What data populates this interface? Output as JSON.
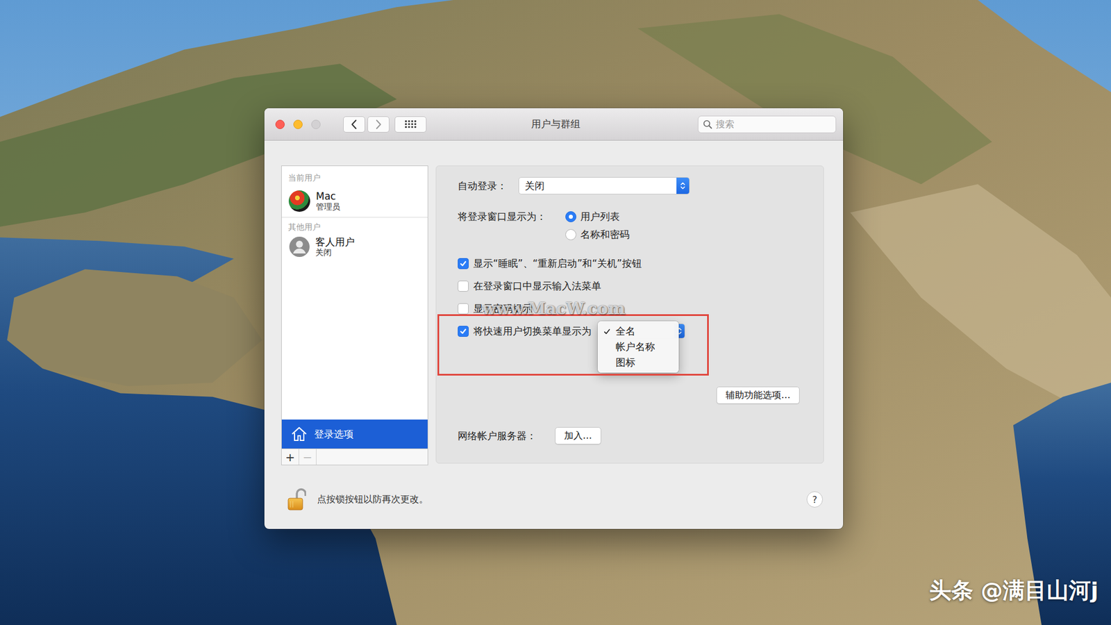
{
  "window": {
    "title": "用户与群组"
  },
  "search": {
    "placeholder": "搜索"
  },
  "sidebar": {
    "sections": [
      {
        "header": "当前用户",
        "users": [
          {
            "name": "Mac",
            "role": "管理员",
            "selected": false
          }
        ]
      },
      {
        "header": "其他用户",
        "users": [
          {
            "name": "客人用户",
            "role": "关闭",
            "selected": false
          }
        ]
      }
    ],
    "login_options": {
      "label": "登录选项",
      "selected": true
    },
    "add": "+",
    "remove": "−",
    "remove_disabled": true
  },
  "settings": {
    "auto_login": {
      "label": "自动登录：",
      "value": "关闭"
    },
    "login_window": {
      "label": "将登录窗口显示为：",
      "options": [
        {
          "label": "用户列表",
          "selected": true
        },
        {
          "label": "名称和密码",
          "selected": false
        }
      ]
    },
    "checkboxes": [
      {
        "label": "显示“睡眠”、“重新启动”和“关机”按钮",
        "checked": true
      },
      {
        "label": "在登录窗口中显示输入法菜单",
        "checked": false
      },
      {
        "label": "显示密码提示",
        "checked": false
      },
      {
        "label": "将快速用户切换菜单显示为",
        "checked": true
      }
    ],
    "fast_switch_menu": {
      "open": true,
      "options": [
        {
          "label": "全名",
          "selected": true
        },
        {
          "label": "帐户名称",
          "selected": false
        },
        {
          "label": "图标",
          "selected": false
        }
      ]
    },
    "accessibility_button": "辅助功能选项…",
    "network_server": {
      "label": "网络帐户服务器：",
      "button": "加入…"
    }
  },
  "footer": {
    "lock_text": "点按锁按钮以防再次更改。",
    "help": "?",
    "locked": false
  },
  "watermarks": [
    "www.MacW.com",
    "头条 @满目山河j"
  ]
}
